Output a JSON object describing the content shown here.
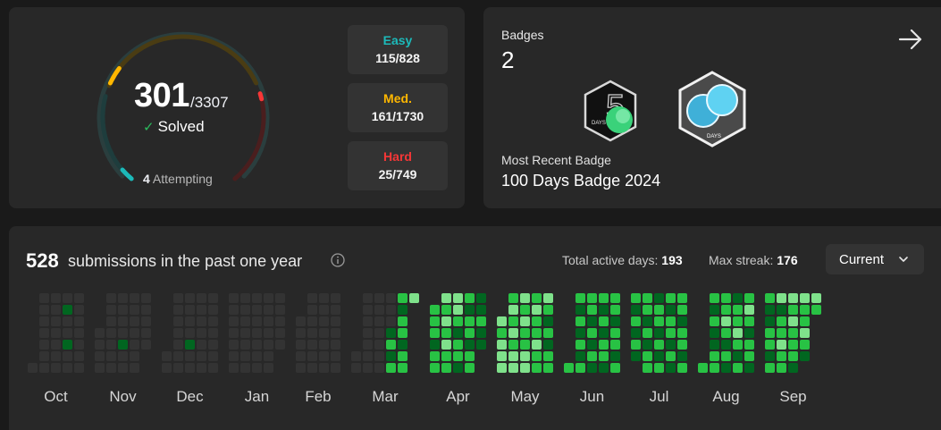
{
  "progress": {
    "solved": "301",
    "total": "/3307",
    "solved_label": "Solved",
    "attempting_count": "4",
    "attempting_label": "Attempting",
    "colors": {
      "easy": "#1cbaba",
      "medium": "#ffb700",
      "hard": "#f63737"
    },
    "fractions": {
      "easy": 0.139,
      "medium": 0.093,
      "hard": 0.033
    },
    "difficulties": [
      {
        "name": "Easy",
        "value": "115/828",
        "color": "#1cbaba"
      },
      {
        "name": "Med.",
        "value": "161/1730",
        "color": "#ffb700"
      },
      {
        "name": "Hard",
        "value": "25/749",
        "color": "#f63737"
      }
    ]
  },
  "badges": {
    "label": "Badges",
    "count": "2",
    "icons": [
      "arrow-right-icon",
      "badge-50-days-icon",
      "badge-100-days-icon"
    ],
    "badge_50_text": "DAYS",
    "badge_100_text": "DAYS",
    "recent_label": "Most Recent Badge",
    "recent_name": "100 Days Badge 2024"
  },
  "calendar": {
    "count": "528",
    "label": "submissions in the past one year",
    "active_days_label": "Total active days:",
    "active_days": "193",
    "max_streak_label": "Max streak:",
    "max_streak": "176",
    "dropdown_value": "Current",
    "colors": {
      "empty": "#333333",
      "l1": "#016620",
      "l2": "#28c244",
      "l3": "#7fe18b",
      "l4": "#9ff0a8"
    },
    "months": [
      {
        "label": "Oct",
        "weeks": [
          [
            -1,
            -1,
            -1,
            -1,
            -1,
            -1,
            0
          ],
          [
            0,
            0,
            0,
            0,
            0,
            0,
            0
          ],
          [
            0,
            0,
            0,
            0,
            0,
            0,
            0
          ],
          [
            0,
            1,
            0,
            0,
            1,
            0,
            0
          ],
          [
            0,
            0,
            0,
            0,
            0,
            0,
            0
          ]
        ]
      },
      {
        "label": "Nov",
        "weeks": [
          [
            -1,
            -1,
            -1,
            0,
            0,
            0,
            0
          ],
          [
            0,
            0,
            0,
            0,
            0,
            0,
            0
          ],
          [
            0,
            0,
            0,
            0,
            1,
            0,
            0
          ],
          [
            0,
            0,
            0,
            0,
            0,
            0,
            0
          ],
          [
            0,
            0,
            0,
            0,
            0,
            -1,
            -1
          ]
        ]
      },
      {
        "label": "Dec",
        "weeks": [
          [
            -1,
            -1,
            -1,
            -1,
            -1,
            0,
            0
          ],
          [
            0,
            0,
            0,
            0,
            0,
            0,
            0
          ],
          [
            0,
            0,
            0,
            0,
            1,
            0,
            0
          ],
          [
            0,
            0,
            0,
            0,
            0,
            0,
            0
          ],
          [
            0,
            0,
            0,
            0,
            0,
            0,
            0
          ]
        ]
      },
      {
        "label": "Jan",
        "weeks": [
          [
            0,
            0,
            0,
            0,
            0,
            0,
            0
          ],
          [
            0,
            0,
            0,
            0,
            0,
            0,
            0
          ],
          [
            0,
            0,
            0,
            0,
            0,
            0,
            0
          ],
          [
            0,
            0,
            0,
            0,
            0,
            0,
            0
          ],
          [
            0,
            0,
            0,
            0,
            0,
            -1,
            -1
          ]
        ]
      },
      {
        "label": "Feb",
        "weeks": [
          [
            -1,
            -1,
            0,
            0,
            0,
            0,
            0
          ],
          [
            0,
            0,
            0,
            0,
            0,
            0,
            0
          ],
          [
            0,
            0,
            0,
            0,
            0,
            0,
            0
          ],
          [
            0,
            0,
            0,
            0,
            0,
            0,
            0
          ]
        ]
      },
      {
        "label": "Mar",
        "weeks": [
          [
            -1,
            -1,
            -1,
            -1,
            -1,
            0,
            0
          ],
          [
            0,
            0,
            0,
            0,
            0,
            0,
            0
          ],
          [
            0,
            0,
            0,
            0,
            0,
            0,
            0
          ],
          [
            0,
            0,
            0,
            1,
            2,
            1,
            2
          ],
          [
            2,
            1,
            2,
            2,
            1,
            2,
            2
          ],
          [
            3,
            -1,
            -1,
            -1,
            -1,
            -1,
            -1
          ]
        ]
      },
      {
        "label": "Apr",
        "weeks": [
          [
            -1,
            2,
            2,
            2,
            1,
            2,
            2
          ],
          [
            3,
            2,
            3,
            2,
            3,
            2,
            2
          ],
          [
            3,
            3,
            2,
            1,
            2,
            2,
            1
          ],
          [
            2,
            1,
            2,
            2,
            1,
            2,
            2
          ],
          [
            1,
            1,
            2,
            1,
            1,
            -1,
            -1
          ]
        ]
      },
      {
        "label": "May",
        "weeks": [
          [
            -1,
            -1,
            3,
            2,
            3,
            3,
            3
          ],
          [
            2,
            3,
            2,
            3,
            2,
            3,
            3
          ],
          [
            3,
            2,
            3,
            2,
            2,
            3,
            3
          ],
          [
            2,
            3,
            2,
            2,
            3,
            2,
            2
          ],
          [
            3,
            2,
            1,
            2,
            1,
            2,
            2
          ]
        ]
      },
      {
        "label": "Jun",
        "weeks": [
          [
            -1,
            -1,
            -1,
            -1,
            -1,
            -1,
            2
          ],
          [
            2,
            1,
            2,
            1,
            2,
            1,
            2
          ],
          [
            2,
            2,
            1,
            2,
            1,
            2,
            1
          ],
          [
            2,
            1,
            2,
            1,
            2,
            2,
            1
          ],
          [
            2,
            2,
            1,
            2,
            2,
            1,
            2
          ]
        ]
      },
      {
        "label": "Jul",
        "weeks": [
          [
            2,
            1,
            2,
            1,
            2,
            1,
            -1
          ],
          [
            2,
            2,
            1,
            2,
            1,
            2,
            2
          ],
          [
            1,
            2,
            2,
            1,
            2,
            1,
            2
          ],
          [
            2,
            1,
            2,
            2,
            1,
            2,
            1
          ],
          [
            2,
            2,
            1,
            2,
            2,
            1,
            2
          ]
        ]
      },
      {
        "label": "Aug",
        "weeks": [
          [
            -1,
            -1,
            -1,
            -1,
            -1,
            -1,
            2
          ],
          [
            2,
            1,
            2,
            1,
            1,
            2,
            2
          ],
          [
            2,
            2,
            3,
            2,
            1,
            2,
            1
          ],
          [
            1,
            2,
            2,
            3,
            2,
            1,
            2
          ],
          [
            2,
            3,
            2,
            1,
            2,
            2,
            1
          ]
        ]
      },
      {
        "label": "Sep",
        "weeks": [
          [
            2,
            1,
            1,
            2,
            2,
            1,
            2
          ],
          [
            3,
            1,
            2,
            2,
            3,
            2,
            2
          ],
          [
            3,
            2,
            3,
            2,
            2,
            2,
            1
          ],
          [
            3,
            2,
            2,
            3,
            2,
            1,
            -1
          ],
          [
            3,
            2,
            -1,
            -1,
            -1,
            -1,
            -1
          ]
        ]
      }
    ]
  }
}
